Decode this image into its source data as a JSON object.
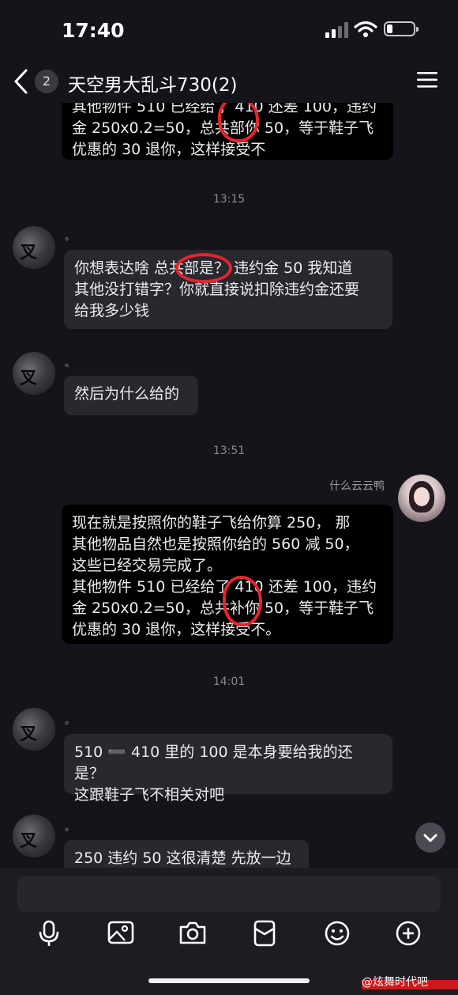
{
  "status": {
    "time": "17:40"
  },
  "header": {
    "unread": "2",
    "title": "天空男大乱斗730(2)"
  },
  "messages": {
    "top_partial_line1": "其他物件 510 已经给了 410 还差 100，违约",
    "top_partial_line2": "金 250x0.2=50，总共部你 50，等于鞋子飞",
    "top_partial_line3": "优惠的 30 退你，这样接受不",
    "ts1": "13:15",
    "m1_name": "。",
    "m1_line1": "你想表达啥 总共部是？ 违约金 50 我知道",
    "m1_line2": "其他没打错字？你就直接说扣除违约金还要",
    "m1_line3": "给我多少钱",
    "m2_name": "。",
    "m2_line1": "然后为什么给的",
    "ts2": "13:51",
    "me_name": "什么云云鸭",
    "m3_line1": "现在就是按照你的鞋子飞给你算 250， 那",
    "m3_line2": "其他物品自然也是按照你给的 560 减 50，",
    "m3_line3": "这些已经交易完成了。",
    "m3_line4": "其他物件 510 已经给了 410 还差 100，违约",
    "m3_line5": "金 250x0.2=50，总共补你 50，等于鞋子飞",
    "m3_line6": "优惠的 30 退你，这样接受不。",
    "ts3": "14:01",
    "m4_name": "。",
    "m4_line1": "510 ➖ 410 里的 100 是本身要给我的还是？",
    "m4_line2": "这跟鞋子飞不相关对吧",
    "m5_name": "。",
    "m5_line1": "250 违约 50 这很清楚 先放一边"
  },
  "watermark": "@炫舞时代吧",
  "colors": {
    "background": "#15141b",
    "bubble": "#28282f",
    "my_bubble": "#000000",
    "annotation": "#e8232c"
  },
  "icons": [
    "back-icon",
    "menu-icon",
    "microphone-icon",
    "image-icon",
    "camera-icon",
    "red-packet-icon",
    "emoji-icon",
    "plus-icon",
    "chevron-down-icon"
  ]
}
